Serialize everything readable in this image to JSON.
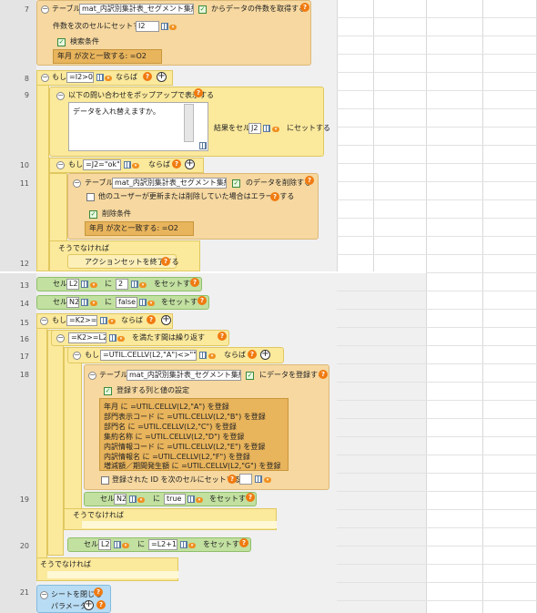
{
  "rows": {
    "r7": "7",
    "r8": "8",
    "r9": "9",
    "r10": "10",
    "r11": "11",
    "r12": "12",
    "r13": "13",
    "r14": "14",
    "r15": "15",
    "r16": "16",
    "r17": "17",
    "r18": "18",
    "r19": "19",
    "r20": "20",
    "r21": "21"
  },
  "labels": {
    "table": "テーブル",
    "from_count": "からデータの件数を取得する",
    "set_count": "件数を次のセルにセットする",
    "search_cond": "検索条件",
    "cond_text": "年月 が次と一致する: =O2",
    "if": "もし",
    "then": "ならば",
    "popup": "以下の問い合わせをポップアップで表示する",
    "popup_msg": "データを入れ替えますか。",
    "result_cell": "結果をセル",
    "set_to": "にセットする",
    "delete_data": "のデータを削除する",
    "other_user": "他のユーザーが更新または削除していた場合はエラーとする",
    "delete_cond": "削除条件",
    "else": "そうでなければ",
    "end_action": "アクションセットを終了する",
    "cell": "セル",
    "ni": "に",
    "set": "をセットする",
    "while": "を満たす間は繰り返す",
    "register": "にデータを登録する",
    "reg_cols": "登録する列と値の設定",
    "reg_id": "登録された ID を次のセルにセットする",
    "close_sheet": "シートを閉じる",
    "params": "パラメータ"
  },
  "values": {
    "table_name": "mat_内訳別集計表_セグメント集約",
    "i2": "I2",
    "j2": "J2",
    "l2": "L2",
    "n2": "N2",
    "two": "2",
    "false": "false",
    "true": "true",
    "cond8": "=I2>0",
    "cond10": "=J2=\"ok\"",
    "cond15": "=K2>=0",
    "cond16": "=K2>=L2",
    "cond17": "=UTIL.CELLV(L2,\"A\")<>\"\"",
    "l2plus": "=L2+1"
  },
  "reg_lines": [
    "年月 に =UTIL.CELLV(L2,\"A\") を登録",
    "部門表示コード に =UTIL.CELLV(L2,\"B\") を登録",
    "部門名 に =UTIL.CELLV(L2,\"C\") を登録",
    "集約名称 に =UTIL.CELLV(L2,\"D\") を登録",
    "内訳情報コード に =UTIL.CELLV(L2,\"E\") を登録",
    "内訳情報名 に =UTIL.CELLV(L2,\"F\") を登録",
    "増減額／期間発生額 に =UTIL.CELLV(L2,\"G\") を登録"
  ]
}
